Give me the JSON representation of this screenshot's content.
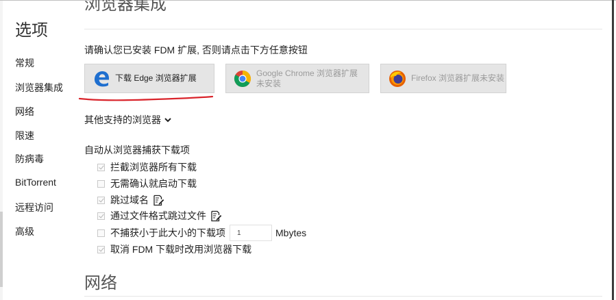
{
  "sidebar": {
    "title": "选项",
    "items": [
      {
        "label": "常规"
      },
      {
        "label": "浏览器集成"
      },
      {
        "label": "网络"
      },
      {
        "label": "限速"
      },
      {
        "label": "防病毒"
      },
      {
        "label": "BitTorrent"
      },
      {
        "label": "远程访问"
      },
      {
        "label": "高级"
      }
    ]
  },
  "main": {
    "cut_header": "浏览器集成",
    "prompt": "请确认您已安装 FDM 扩展, 否则请点击下方任意按钮",
    "buttons": {
      "edge": {
        "line1": "下载 Edge 浏览器扩展",
        "line2": ""
      },
      "chrome": {
        "line1": "Google Chrome 浏览器扩展",
        "line2": "未安装"
      },
      "firefox": {
        "line1": "Firefox 浏览器扩展未安装",
        "line2": ""
      }
    },
    "other_browsers": "其他支持的浏览器",
    "capture_title": "自动从浏览器捕获下载项",
    "options": [
      {
        "label": "拦截浏览器所有下载",
        "checked": true
      },
      {
        "label": "无需确认就启动下载",
        "checked": false
      },
      {
        "label": "跳过域名",
        "checked": true
      },
      {
        "label": "通过文件格式跳过文件",
        "checked": true
      },
      {
        "label": "不捕获小于此大小的下载项",
        "checked": false
      },
      {
        "label": "取消 FDM 下载时改用浏览器下载",
        "checked": true
      }
    ],
    "min_size": {
      "value": "1",
      "unit": "Mbytes"
    },
    "next_section": "网络"
  },
  "colors": {
    "red_underline": "#d9232a",
    "edge_blue": "#1f6fcf"
  }
}
